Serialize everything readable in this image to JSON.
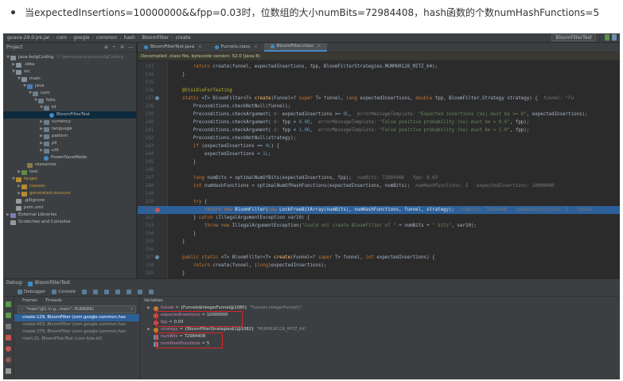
{
  "caption": {
    "text": "当expectedInsertions=10000000&&fpp=0.03时，位数组的大小numBits=72984408，hash函数的个数numHashFunctions=5"
  },
  "navbar": {
    "crumbs": [
      "guava-29.0-jre.jar",
      "com",
      "google",
      "common",
      "hash",
      "BloomFilter",
      "create"
    ],
    "run_config": "BloomFilterTest"
  },
  "project": {
    "title": "Project",
    "tree": [
      {
        "indent": 0,
        "arrow": "▼",
        "icon": "folder",
        "label": "java-bolgCoding",
        "hint": "C:\\workspace\\java-bolgCoding",
        "cls": ""
      },
      {
        "indent": 1,
        "arrow": "▶",
        "icon": "folder",
        "label": ".idea",
        "hint": "",
        "cls": ""
      },
      {
        "indent": 1,
        "arrow": "▼",
        "icon": "folder",
        "label": "src",
        "hint": "",
        "cls": ""
      },
      {
        "indent": 2,
        "arrow": "▼",
        "icon": "folder",
        "label": "main",
        "hint": "",
        "cls": ""
      },
      {
        "indent": 3,
        "arrow": "▼",
        "icon": "folder-src",
        "label": "java",
        "hint": "",
        "cls": ""
      },
      {
        "indent": 4,
        "arrow": "▼",
        "icon": "pkg",
        "label": "com",
        "hint": "",
        "cls": ""
      },
      {
        "indent": 5,
        "arrow": "▼",
        "icon": "pkg",
        "label": "fobs",
        "hint": "",
        "cls": ""
      },
      {
        "indent": 6,
        "arrow": "▼",
        "icon": "pkg",
        "label": "bf",
        "hint": "",
        "cls": ""
      },
      {
        "indent": 7,
        "arrow": "",
        "icon": "class",
        "label": "BloomFilterTest",
        "hint": "",
        "cls": "selected"
      },
      {
        "indent": 6,
        "arrow": "▶",
        "icon": "pkg",
        "label": "currency",
        "hint": "",
        "cls": ""
      },
      {
        "indent": 6,
        "arrow": "▶",
        "icon": "pkg",
        "label": "language",
        "hint": "",
        "cls": ""
      },
      {
        "indent": 6,
        "arrow": "▶",
        "icon": "pkg",
        "label": "pattern",
        "hint": "",
        "cls": ""
      },
      {
        "indent": 6,
        "arrow": "▶",
        "icon": "pkg",
        "label": "pil",
        "hint": "",
        "cls": ""
      },
      {
        "indent": 6,
        "arrow": "▶",
        "icon": "pkg",
        "label": "util",
        "hint": "",
        "cls": ""
      },
      {
        "indent": 6,
        "arrow": "",
        "icon": "class",
        "label": "PowerSaveMode",
        "hint": "",
        "cls": ""
      },
      {
        "indent": 3,
        "arrow": "",
        "icon": "folder-res",
        "label": "resources",
        "hint": "",
        "cls": ""
      },
      {
        "indent": 2,
        "arrow": "▶",
        "icon": "folder-test",
        "label": "test",
        "hint": "",
        "cls": ""
      },
      {
        "indent": 1,
        "arrow": "▼",
        "icon": "folder-target",
        "label": "target",
        "hint": "",
        "cls": "orange"
      },
      {
        "indent": 2,
        "arrow": "▶",
        "icon": "folder-target",
        "label": "classes",
        "hint": "",
        "cls": "orange"
      },
      {
        "indent": 2,
        "arrow": "▶",
        "icon": "folder-target",
        "label": "generated-sources",
        "hint": "",
        "cls": "orange"
      },
      {
        "indent": 1,
        "arrow": "",
        "icon": "file",
        "label": ".gitignore",
        "hint": "",
        "cls": ""
      },
      {
        "indent": 1,
        "arrow": "",
        "icon": "file",
        "label": "pom.xml",
        "hint": "",
        "cls": ""
      },
      {
        "indent": 0,
        "arrow": "▶",
        "icon": "lib",
        "label": "External Libraries",
        "hint": "",
        "cls": ""
      },
      {
        "indent": 0,
        "arrow": "",
        "icon": "file",
        "label": "Scratches and Consoles",
        "hint": "",
        "cls": ""
      }
    ]
  },
  "editor": {
    "tabs": [
      {
        "label": "BloomFilterTest.java",
        "active": false
      },
      {
        "label": "Funnels.class",
        "active": false
      },
      {
        "label": "BloomFilter.class",
        "active": true
      }
    ],
    "decompiled_notice": "Decompiled .class file, bytecode version: 52.0 (Java 8)",
    "lines": [
      {
        "n": "133",
        "m": "",
        "cur": false,
        "html": "        <span class=\"kw\">return</span> create(funnel, expectedInsertions, fpp, BloomFilterStrategies.MURMUR128_MITZ_64);"
      },
      {
        "n": "134",
        "m": "",
        "cur": false,
        "html": "    }"
      },
      {
        "n": "135",
        "m": "",
        "cur": false,
        "html": ""
      },
      {
        "n": "136",
        "m": "",
        "cur": false,
        "html": "    <span class=\"ann\">@VisibleForTesting</span>"
      },
      {
        "n": "137",
        "m": "impl",
        "cur": false,
        "html": "    <span class=\"kw\">static</span> &lt;T&gt; BloomFilter&lt;T&gt; <span class=\"fn\">create</span>(Funnel&lt;? <span class=\"kw\">super</span> T&gt; funnel, <span class=\"kw\">long</span> expectedInsertions, <span class=\"kw\">double</span> fpp, BloomFilter.Strategy strategy) {  <span class=\"inl\">funnel: \"Fu</span>"
      },
      {
        "n": "138",
        "m": "",
        "cur": false,
        "html": "        Preconditions.checkNotNull(funnel);"
      },
      {
        "n": "139",
        "m": "",
        "cur": false,
        "html": "        Preconditions.checkArgument( <span class=\"inl\">b:</span> expectedInsertions &gt;= <span class=\"numc\">0L</span>,  <span class=\"inl\">errorMessageTemplate:</span> <span class=\"str\">\"Expected insertions (%s) must be &gt;= 0\"</span>, expectedInsertions);"
      },
      {
        "n": "140",
        "m": "",
        "cur": false,
        "html": "        Preconditions.checkArgument( <span class=\"inl\">b:</span> fpp &gt; <span class=\"numc\">0.0D</span>,  <span class=\"inl\">errorMessageTemplate:</span> <span class=\"str\">\"False positive probability (%s) must be &gt; 0.0\"</span>, fpp);"
      },
      {
        "n": "141",
        "m": "",
        "cur": false,
        "html": "        Preconditions.checkArgument( <span class=\"inl\">b:</span> fpp &lt; <span class=\"numc\">1.0D</span>,  <span class=\"inl\">errorMessageTemplate:</span> <span class=\"str\">\"False positive probability (%s) must be &lt; 1.0\"</span>, fpp);"
      },
      {
        "n": "142",
        "m": "",
        "cur": false,
        "html": "        Preconditions.checkNotNull(strategy);"
      },
      {
        "n": "143",
        "m": "",
        "cur": false,
        "html": "        <span class=\"kw\">if</span> (expectedInsertions == <span class=\"numc\">0L</span>) {"
      },
      {
        "n": "144",
        "m": "",
        "cur": false,
        "html": "            expectedInsertions = <span class=\"numc\">1L</span>;"
      },
      {
        "n": "145",
        "m": "",
        "cur": false,
        "html": "        }"
      },
      {
        "n": "146",
        "m": "",
        "cur": false,
        "html": ""
      },
      {
        "n": "147",
        "m": "",
        "cur": false,
        "html": "        <span class=\"kw\">long</span> numBits = optimalNumOfBits(expectedInsertions, fpp);  <span class=\"inl\">numBits: 72984408   fpp: 0.03</span>"
      },
      {
        "n": "148",
        "m": "",
        "cur": false,
        "html": "        <span class=\"kw\">int</span> numHashFunctions = optimalNumOfHashFunctions(expectedInsertions, numBits);  <span class=\"inl\">numHashFunctions: 5   expectedInsertions: 10000000</span>"
      },
      {
        "n": "149",
        "m": "",
        "cur": false,
        "html": ""
      },
      {
        "n": "150",
        "m": "",
        "cur": false,
        "html": "        <span class=\"kw\">try</span> {"
      },
      {
        "n": "151",
        "m": "bp",
        "cur": true,
        "html": "            <span class=\"kw\">return new</span> BloomFilter(<span class=\"kw\">new</span> LockFreeBitArray(numBits), numHashFunctions, funnel, strategy);  <span class=\"inl\">numBits: 72984408   numHashFunctions: 5   funnel</span>"
      },
      {
        "n": "152",
        "m": "",
        "cur": false,
        "html": "        } <span class=\"kw\">catch</span> (IllegalArgumentException var10) {"
      },
      {
        "n": "153",
        "m": "",
        "cur": false,
        "html": "            <span class=\"kw\">throw new</span> IllegalArgumentException(<span class=\"str\">\"Could not create BloomFilter of \"</span> + numBits + <span class=\"str\">\" bits\"</span>, var10);"
      },
      {
        "n": "154",
        "m": "",
        "cur": false,
        "html": "        }"
      },
      {
        "n": "155",
        "m": "",
        "cur": false,
        "html": "    }"
      },
      {
        "n": "156",
        "m": "",
        "cur": false,
        "html": ""
      },
      {
        "n": "157",
        "m": "impl",
        "cur": false,
        "html": "    <span class=\"kw\">public static</span> &lt;T&gt; BloomFilter&lt;T&gt; <span class=\"fn\">create</span>(Funnel&lt;? <span class=\"kw\">super</span> T&gt; funnel, <span class=\"kw\">int</span> expectedInsertions) {"
      },
      {
        "n": "158",
        "m": "",
        "cur": false,
        "html": "        <span class=\"kw\">return</span> create(funnel, (<span class=\"kw\">long</span>)expectedInsertions);"
      },
      {
        "n": "159",
        "m": "",
        "cur": false,
        "html": "    }"
      }
    ]
  },
  "debug": {
    "title": "Debug:",
    "config": "BloomFilterTest",
    "toolbar": [
      "Debugger",
      "Console"
    ],
    "frames_label": "Frames",
    "threads_label": "Threads",
    "thread": "\"main\"@1 in g...main\": RUNNING",
    "frames": [
      {
        "text": "create:129, BloomFilter (com.google.common.has",
        "sel": true
      },
      {
        "text": "create:403, BloomFilter (com.google.common.has",
        "sel": false
      },
      {
        "text": "create:379, BloomFilter (com.google.common.has",
        "sel": false
      },
      {
        "text": "main:21, BloomFilterTest (com.fobs.bf)",
        "sel": false
      }
    ],
    "variables_label": "Variables",
    "vars": [
      {
        "expand": "▶",
        "icon": "obj",
        "name": "funnel",
        "value": "{Funnels$IntegerFunnel@1080}",
        "type": "\"Funnels.integerFunnel()\""
      },
      {
        "expand": "",
        "icon": "prim",
        "name": "expectedInsertions",
        "value": "10000000",
        "type": ""
      },
      {
        "expand": "",
        "icon": "prim",
        "name": "fpp",
        "value": "0.03",
        "type": ""
      },
      {
        "expand": "▶",
        "icon": "obj",
        "name": "strategy",
        "value": "{BloomFilterStrategies$1@1082}",
        "type": "\"MURMUR128_MITZ_64\""
      },
      {
        "expand": "",
        "icon": "field",
        "name": "numBits",
        "value": "72984408",
        "type": ""
      },
      {
        "expand": "",
        "icon": "field",
        "name": "numHashFunctions",
        "value": "5",
        "type": ""
      }
    ]
  },
  "colors": {
    "highlight_box": "#d6262a",
    "current_line": "#2d6099",
    "breakpoint": "#c75450"
  }
}
